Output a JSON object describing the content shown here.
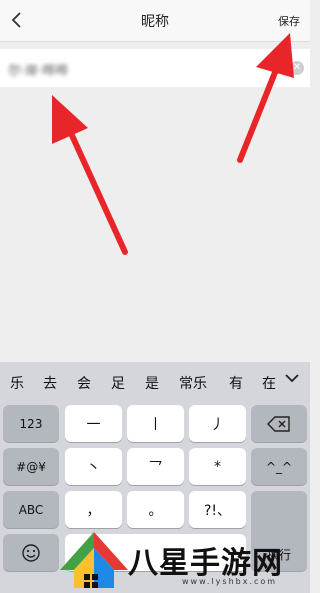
{
  "nav": {
    "title": "昵称",
    "save_label": "保存"
  },
  "nickname_field": {
    "value": "尔·岸·哗哗"
  },
  "keyboard": {
    "candidates": [
      "乐",
      "去",
      "会",
      "足",
      "是",
      "常乐",
      "有",
      "在"
    ],
    "keys": {
      "k123": "123",
      "symbols": "#@¥",
      "abc": "ABC",
      "stroke_horizontal": "一",
      "stroke_vertical": "丨",
      "stroke_left_falling": "丿",
      "stroke_dot": "丶",
      "stroke_turn": "乛",
      "wildcard": "*",
      "comma": "，",
      "period": "。",
      "punct": "?!、",
      "emoticon": "^_^",
      "newline_partial": "换行"
    }
  },
  "watermark": {
    "brand": "八星手游网",
    "url": "www.lyshbx.com"
  },
  "colors": {
    "annotation_arrow": "#e8262a",
    "function_key": "#b3b7be",
    "keyboard_bg": "#d4d6db"
  }
}
